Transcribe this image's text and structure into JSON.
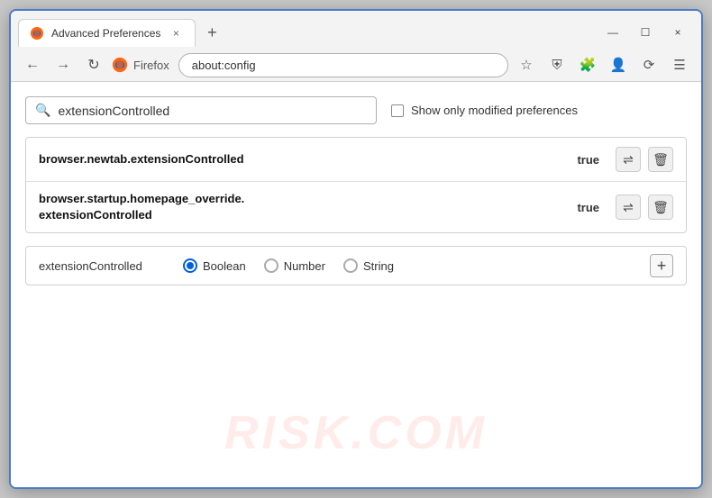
{
  "window": {
    "title": "Advanced Preferences",
    "tab_close": "×",
    "new_tab": "+",
    "win_minimize": "—",
    "win_maximize": "☐",
    "win_close": "×"
  },
  "nav": {
    "back": "←",
    "forward": "→",
    "reload": "↻",
    "firefox_label": "Firefox",
    "address": "about:config",
    "bookmark_icon": "☆",
    "shield_icon": "⛨",
    "extension_icon": "🧩",
    "profile_icon": "👤",
    "synced_icon": "⟳",
    "menu_icon": "☰"
  },
  "search": {
    "placeholder": "extensionControlled",
    "value": "extensionControlled",
    "search_icon": "🔍",
    "checkbox_label": "Show only modified preferences"
  },
  "results": [
    {
      "name": "browser.newtab.extensionControlled",
      "value": "true"
    },
    {
      "name": "browser.startup.homepage_override.\nextensionControlled",
      "name_line1": "browser.startup.homepage_override.",
      "name_line2": "extensionControlled",
      "value": "true",
      "multiline": true
    }
  ],
  "add_pref": {
    "name": "extensionControlled",
    "types": [
      {
        "label": "Boolean",
        "selected": true
      },
      {
        "label": "Number",
        "selected": false
      },
      {
        "label": "String",
        "selected": false
      }
    ],
    "add_btn": "+"
  },
  "watermark": "RISK.COM",
  "action_icons": {
    "swap": "⇌",
    "delete": "🗑"
  }
}
